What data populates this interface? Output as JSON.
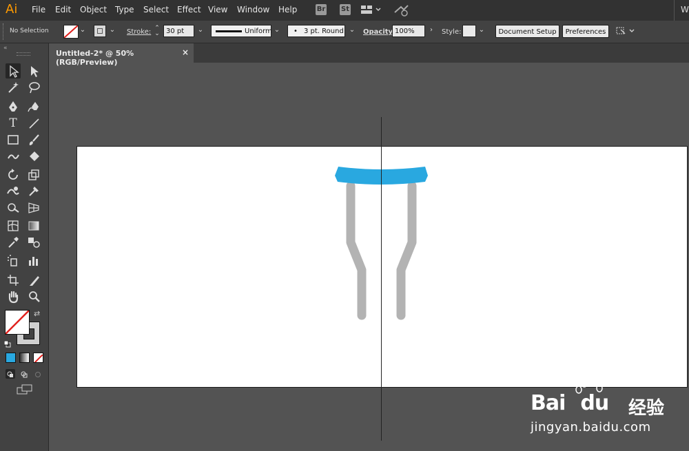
{
  "app": {
    "logo": "Ai",
    "menu": [
      "File",
      "Edit",
      "Object",
      "Type",
      "Select",
      "Effect",
      "View",
      "Window",
      "Help"
    ],
    "badges": [
      "Br",
      "St"
    ],
    "right_text": "W"
  },
  "control": {
    "selection_status": "No Selection",
    "stroke_label": "Stroke:",
    "stroke_weight": "30 pt",
    "profile": "Uniform",
    "brush": "3 pt. Round",
    "opacity_label": "Opacity:",
    "opacity_value": "100%",
    "style_label": "Style:",
    "document_setup": "Document Setup",
    "preferences": "Preferences"
  },
  "document": {
    "tab_title": "Untitled-2* @ 50% (RGB/Preview)",
    "close_glyph": "×"
  },
  "tools": {
    "icons": [
      "selection-tool",
      "direct-selection-tool",
      "magic-wand-tool",
      "lasso-tool",
      "pen-tool",
      "curvature-tool",
      "type-tool",
      "line-tool",
      "rectangle-tool",
      "paintbrush-tool",
      "shaper-tool",
      "eraser-tool",
      "rotate-tool",
      "scale-tool",
      "warp-tool",
      "free-transform-tool",
      "shape-builder-tool",
      "perspective-grid-tool",
      "mesh-tool",
      "gradient-tool",
      "eyedropper-tool",
      "blend-tool",
      "symbol-sprayer-tool",
      "column-graph-tool",
      "artboard-tool",
      "slice-tool",
      "hand-tool",
      "zoom-tool"
    ]
  },
  "colors": {
    "accent": "#29a8e0",
    "crutch_gray": "#b3b3b3",
    "artboard": "#ffffff",
    "canvas": "#535353"
  },
  "watermark": {
    "brand": "Bai",
    "brand2": "du",
    "cn": "经验",
    "url": "jingyan.baidu.com"
  }
}
